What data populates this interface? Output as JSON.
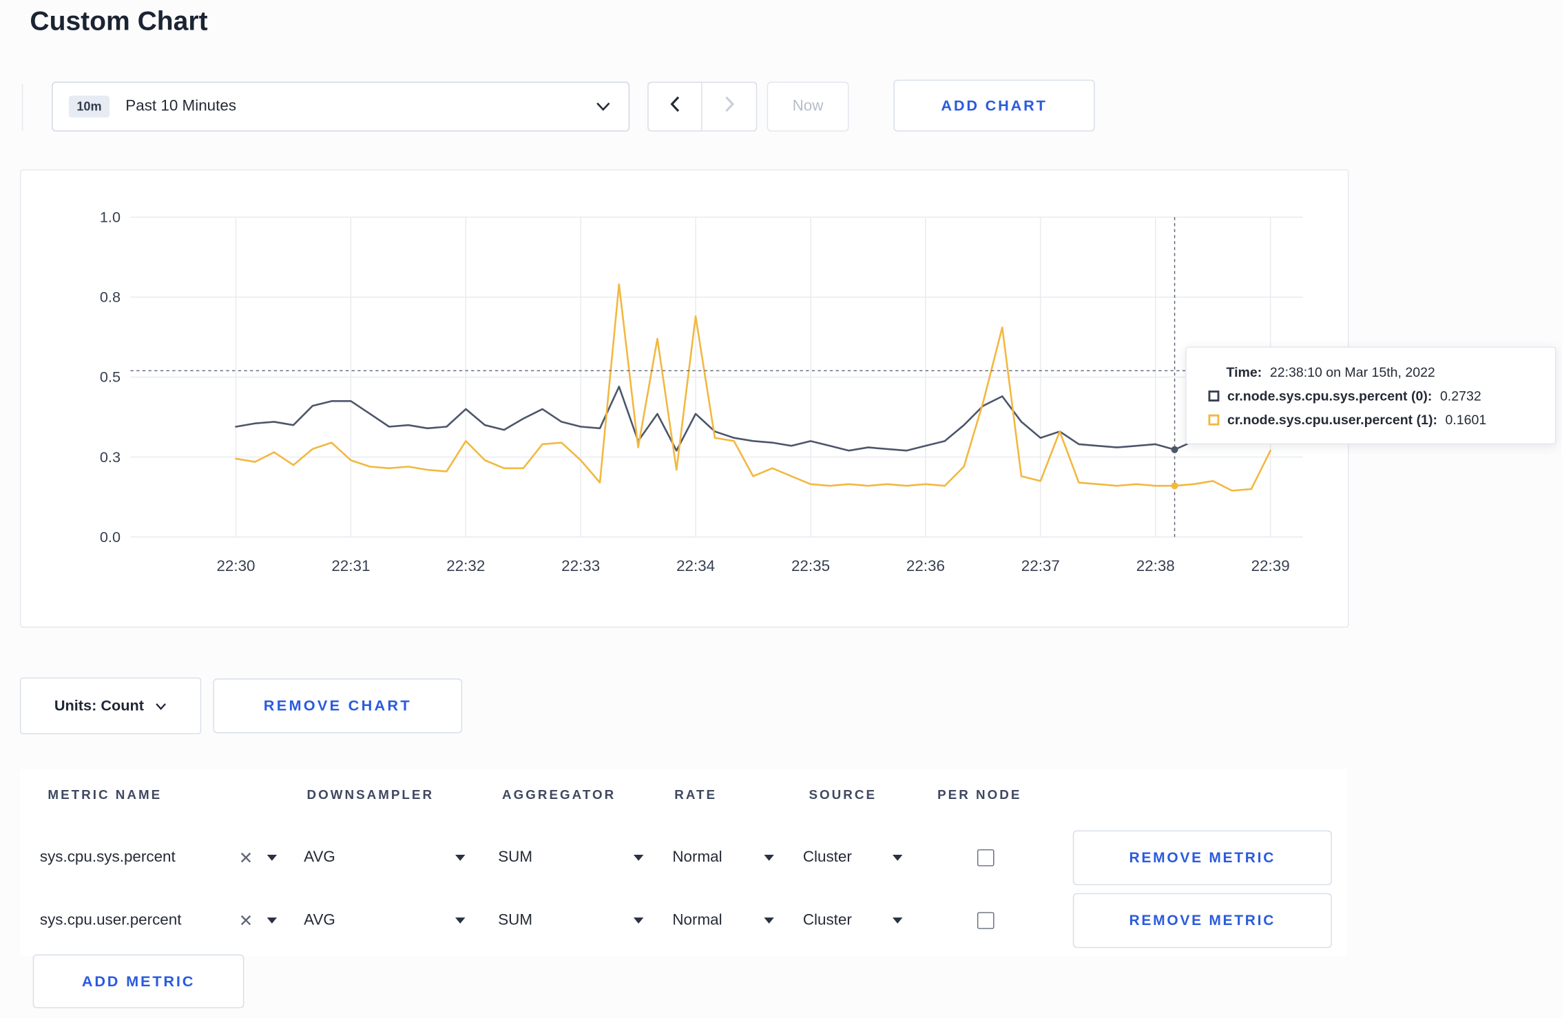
{
  "theme": {
    "accent_blue": "#2a5bdf",
    "series_sys_color": "#4c566a",
    "series_user_color": "#f2b840",
    "gridline_color": "#e8eaef",
    "crosshair_color": "#5a6373"
  },
  "page": {
    "title": "Custom Chart"
  },
  "toolbar": {
    "time_badge": "10m",
    "time_label": "Past 10 Minutes",
    "now_label": "Now",
    "add_chart_label": "ADD CHART"
  },
  "chart_data": {
    "type": "line",
    "title": "",
    "xlabel": "",
    "ylabel": "",
    "ylim": [
      0,
      1
    ],
    "x_domain_seconds": [
      -55,
      557
    ],
    "x_ticks": [
      {
        "t": 0,
        "label": "22:30"
      },
      {
        "t": 60,
        "label": "22:31"
      },
      {
        "t": 120,
        "label": "22:32"
      },
      {
        "t": 180,
        "label": "22:33"
      },
      {
        "t": 240,
        "label": "22:34"
      },
      {
        "t": 300,
        "label": "22:35"
      },
      {
        "t": 360,
        "label": "22:36"
      },
      {
        "t": 420,
        "label": "22:37"
      },
      {
        "t": 480,
        "label": "22:38"
      },
      {
        "t": 540,
        "label": "22:39"
      }
    ],
    "y_ticks": [
      {
        "value": 0.0,
        "label": "0.0"
      },
      {
        "value": 0.25,
        "label": "0.3"
      },
      {
        "value": 0.5,
        "label": "0.5"
      },
      {
        "value": 0.75,
        "label": "0.8"
      },
      {
        "value": 1.0,
        "label": "1.0"
      }
    ],
    "series": [
      {
        "name": "cr.node.sys.cpu.sys.percent",
        "color": "#4c566a",
        "t0": 0,
        "dt": 10,
        "values": [
          0.345,
          0.355,
          0.36,
          0.35,
          0.41,
          0.425,
          0.425,
          0.385,
          0.345,
          0.35,
          0.34,
          0.345,
          0.4,
          0.35,
          0.335,
          0.37,
          0.4,
          0.36,
          0.345,
          0.34,
          0.47,
          0.3,
          0.385,
          0.27,
          0.385,
          0.33,
          0.31,
          0.3,
          0.295,
          0.285,
          0.3,
          0.285,
          0.27,
          0.28,
          0.275,
          0.27,
          0.285,
          0.3,
          0.35,
          0.41,
          0.44,
          0.36,
          0.31,
          0.33,
          0.29,
          0.285,
          0.28,
          0.285,
          0.29,
          0.2732,
          0.3,
          0.315,
          0.3,
          0.295,
          0.33
        ]
      },
      {
        "name": "cr.node.sys.cpu.user.percent",
        "color": "#f2b840",
        "t0": 0,
        "dt": 10,
        "values": [
          0.245,
          0.235,
          0.265,
          0.225,
          0.275,
          0.295,
          0.24,
          0.22,
          0.215,
          0.22,
          0.21,
          0.205,
          0.3,
          0.24,
          0.215,
          0.215,
          0.29,
          0.295,
          0.24,
          0.17,
          0.79,
          0.28,
          0.62,
          0.21,
          0.69,
          0.31,
          0.3,
          0.19,
          0.215,
          0.19,
          0.165,
          0.16,
          0.165,
          0.16,
          0.165,
          0.16,
          0.165,
          0.16,
          0.22,
          0.42,
          0.655,
          0.19,
          0.175,
          0.33,
          0.17,
          0.165,
          0.16,
          0.165,
          0.16,
          0.1601,
          0.165,
          0.175,
          0.145,
          0.15,
          0.27
        ]
      }
    ],
    "crosshair": {
      "t": 490,
      "h_value": 0.52
    },
    "hover_points": [
      {
        "series": 0,
        "t": 490,
        "v": 0.2732
      },
      {
        "series": 1,
        "t": 490,
        "v": 0.1601
      }
    ],
    "legend_position": "tooltip",
    "grid": true
  },
  "tooltip": {
    "time_label": "Time:",
    "time_value": "22:38:10 on Mar 15th, 2022",
    "rows": [
      {
        "name": "cr.node.sys.cpu.sys.percent (0):",
        "value": "0.2732",
        "color": "#394150"
      },
      {
        "name": "cr.node.sys.cpu.user.percent (1):",
        "value": "0.1601",
        "color": "#f2b840"
      }
    ]
  },
  "chart_controls": {
    "units_label": "Units: Count",
    "remove_chart_label": "REMOVE CHART"
  },
  "metrics_table": {
    "headers": [
      "METRIC NAME",
      "DOWNSAMPLER",
      "AGGREGATOR",
      "RATE",
      "SOURCE",
      "PER NODE"
    ],
    "rows": [
      {
        "metric": "sys.cpu.sys.percent",
        "downsampler": "AVG",
        "aggregator": "SUM",
        "rate": "Normal",
        "source": "Cluster",
        "per_node_checked": false,
        "remove_label": "REMOVE METRIC"
      },
      {
        "metric": "sys.cpu.user.percent",
        "downsampler": "AVG",
        "aggregator": "SUM",
        "rate": "Normal",
        "source": "Cluster",
        "per_node_checked": false,
        "remove_label": "REMOVE METRIC"
      }
    ],
    "add_metric_label": "ADD METRIC"
  }
}
